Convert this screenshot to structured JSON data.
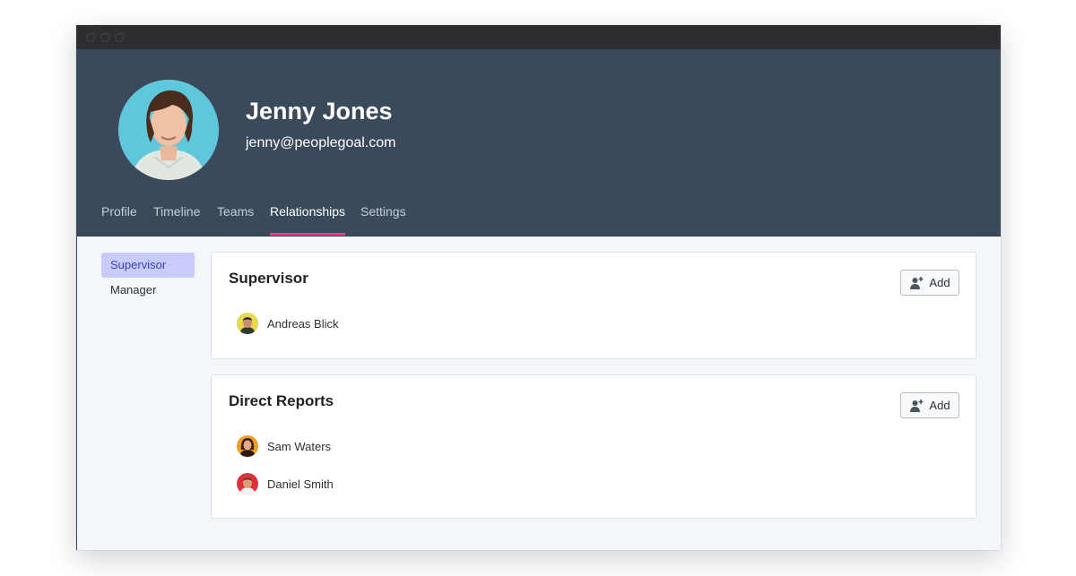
{
  "profile": {
    "name": "Jenny Jones",
    "email": "jenny@peoplegoal.com"
  },
  "tabs": [
    {
      "label": "Profile"
    },
    {
      "label": "Timeline"
    },
    {
      "label": "Teams"
    },
    {
      "label": "Relationships",
      "active": true
    },
    {
      "label": "Settings"
    }
  ],
  "sidebar": {
    "items": [
      {
        "label": "Supervisor",
        "active": true
      },
      {
        "label": "Manager"
      }
    ]
  },
  "supervisor_card": {
    "title": "Supervisor",
    "add_label": "Add",
    "people": [
      {
        "name": "Andreas Blick"
      }
    ]
  },
  "reports_card": {
    "title": "Direct Reports",
    "add_label": "Add",
    "people": [
      {
        "name": "Sam Waters"
      },
      {
        "name": "Daniel Smith"
      }
    ]
  },
  "colors": {
    "header_bg": "#3a4a5a",
    "accent_underline": "#e83e8c",
    "sidebar_active_bg": "#c9ccfb",
    "sidebar_active_text": "#3b3fb8"
  }
}
